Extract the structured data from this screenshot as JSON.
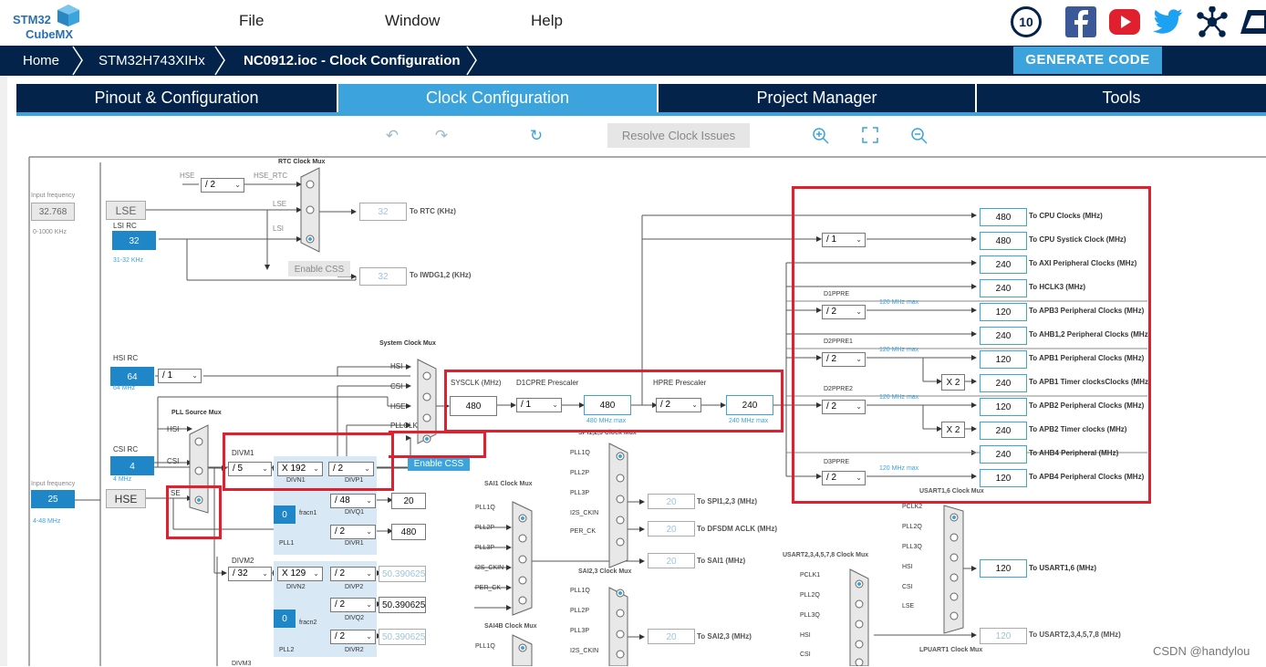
{
  "logo": {
    "line1": "STM32",
    "line2": "CubeMX"
  },
  "menu": [
    "File",
    "Window",
    "Help"
  ],
  "breadcrumb": [
    "Home",
    "STM32H743XIHx",
    "NC0912.ioc - Clock Configuration"
  ],
  "generate_label": "GENERATE CODE",
  "tabs": [
    "Pinout & Configuration",
    "Clock Configuration",
    "Project Manager",
    "Tools"
  ],
  "toolbar": {
    "resolve_label": "Resolve Clock Issues"
  },
  "badge_10": "10",
  "watermark": "CSDN @handylou",
  "colors": {
    "navy": "#03234b",
    "accent": "#3ca3dc",
    "highlight_red": "#e0202e",
    "box_blue": "#1f86c8"
  },
  "icons": [
    "undo-icon",
    "redo-icon",
    "refresh-icon",
    "zoom-in-icon",
    "fit-screen-icon",
    "zoom-out-icon",
    "facebook-icon",
    "youtube-icon",
    "twitter-icon",
    "network-icon"
  ],
  "clock": {
    "input_freq_label": "Input frequency",
    "lse_value": "32.768",
    "lse_range": "0-1000 KHz",
    "lse_label": "LSE",
    "lsi_rc_label": "LSI RC",
    "lsi_value": "32",
    "lsi_range": "31-32 KHz",
    "rtc_mux_label": "RTC Clock Mux",
    "hse_label_small": "HSE",
    "hse_rtc_label": "HSE_RTC",
    "lse_small": "LSE",
    "lsi_small": "LSI",
    "div2": "/ 2",
    "rtc_value": "32",
    "rtc_out": "To RTC (KHz)",
    "enable_css": "Enable CSS",
    "iwdg_value": "32",
    "iwdg_out": "To IWDG1,2 (KHz)",
    "hsi_rc_label": "HSI RC",
    "hsi_value": "64",
    "hsi_freq": "64 MHz",
    "hsi_div": "/ 1",
    "csi_rc_label": "CSI RC",
    "csi_value": "4",
    "csi_freq": "4 MHz",
    "hse_input_label": "Input frequency",
    "hse_value": "25",
    "hse_range": "4-48 MHz",
    "hse_box": "HSE",
    "pll_source_mux": "PLL Source Mux",
    "pll_hsi": "HSI",
    "pll_csi": "CSI",
    "pll_se": "SE",
    "sys_mux": "System Clock Mux",
    "sys_hsi": "HSI",
    "sys_csi": "CSI",
    "sys_hse": "HSE",
    "sys_pllclk": "PLLCLK",
    "sysclk_label": "SYSCLK (MHz)",
    "sysclk_value": "480",
    "d1cpre_label": "D1CPRE Prescaler",
    "d1cpre_value": "/ 1",
    "d1cpre_out": "480",
    "d1cpre_max": "480 MHz max",
    "hpre_label": "HPRE Prescaler",
    "hpre_value": "/ 2",
    "hpre_out": "240",
    "hpre_max": "240 MHz max",
    "divm1_label": "DIVM1",
    "divm1_value": "/ 5",
    "divn1_value": "X 192",
    "divn1_label": "DIVN1",
    "divp1_value": "/ 2",
    "divp1_label": "DIVP1",
    "fracn1_value": "0",
    "fracn1_label": "fracn1",
    "divq1_value": "/ 48",
    "divq1_label": "DIVQ1",
    "divq1_out": "20",
    "divr1_value": "/ 2",
    "divr1_label": "DIVR1",
    "divr1_out": "480",
    "pll1_label": "PLL1",
    "divm2_label": "DIVM2",
    "divm2_value": "/ 32",
    "divn2_value": "X 129",
    "divn2_label": "DIVN2",
    "divp2_value": "/ 2",
    "divp2_label": "DIVP2",
    "divp2_out": "50.390625",
    "fracn2_value": "0",
    "fracn2_label": "fracn2",
    "divq2_value": "/ 2",
    "divq2_label": "DIVQ2",
    "divq2_out": "50.390625",
    "divr2_value": "/ 2",
    "divr2_label": "DIVR2",
    "divr2_out": "50.390625",
    "pll2_label": "PLL2",
    "divm3_label": "DIVM3",
    "spi123_mux": "SPI1,2,3 Clock Mux",
    "spi_pll1q": "PLL1Q",
    "spi_pll2p": "PLL2P",
    "spi_pll3p": "PLL3P",
    "spi_i2sckin": "I2S_CKIN",
    "spi_perck": "PER_CK",
    "spi_value": "20",
    "spi_out": "To SPI1,2,3 (MHz)",
    "dfsdm_value": "20",
    "dfsdm_out": "To DFSDM ACLK (MHz)",
    "sai1_mux": "SAI1 Clock Mux",
    "sai1_pll1q": "PLL1Q",
    "sai1_pll2p": "PLL2P",
    "sai1_pll3p": "PLL3P",
    "sai1_i2sckin": "I2S_CKIN",
    "sai1_perck": "PER_CK",
    "sai1_value": "20",
    "sai1_out": "To SAI1 (MHz)",
    "sai23_mux": "SAI2,3 Clock Mux",
    "sai23_pll1q": "PLL1Q",
    "sai23_pll2p": "PLL2P",
    "sai23_pll3p": "PLL3P",
    "sai23_i2sckin": "I2S_CKIN",
    "sai23_value": "20",
    "sai23_out": "To SAI2,3 (MHz)",
    "sai4b_mux": "SAI4B Clock Mux",
    "sai4b_pll1q": "PLL1Q",
    "cpu_div": "/ 1",
    "d1ppre_label": "D1PPRE",
    "d1ppre_value": "/ 2",
    "d2ppre1_label": "D2PPRE1",
    "d2ppre1_value": "/ 2",
    "d2ppre2_label": "D2PPRE2",
    "d2ppre2_value": "/ 2",
    "d3ppre_label": "D3PPRE",
    "d3ppre_value": "/ 2",
    "max120": "120 MHz max",
    "x2": "X 2",
    "outputs": [
      {
        "value": "480",
        "label": "To CPU Clocks (MHz)"
      },
      {
        "value": "480",
        "label": "To CPU Systick Clock (MHz)"
      },
      {
        "value": "240",
        "label": "To AXI Peripheral Clocks (MHz)"
      },
      {
        "value": "240",
        "label": "To HCLK3 (MHz)"
      },
      {
        "value": "120",
        "label": "To APB3 Peripheral Clocks (MHz)"
      },
      {
        "value": "240",
        "label": "To AHB1,2 Peripheral Clocks (MHz)"
      },
      {
        "value": "120",
        "label": "To APB1 Peripheral Clocks (MHz)"
      },
      {
        "value": "240",
        "label": "To APB1 Timer clocksClocks (MHz)"
      },
      {
        "value": "120",
        "label": "To APB2 Peripheral Clocks (MHz)"
      },
      {
        "value": "240",
        "label": "To APB2 Timer clocks (MHz)"
      },
      {
        "value": "240",
        "label": "To AHB4 Peripheral (MHz)"
      },
      {
        "value": "120",
        "label": "To APB4 Peripheral Clocks (MHz)"
      }
    ],
    "usart16_mux": "USART1,6 Clock Mux",
    "usart16_inputs": [
      "PCLK2",
      "PLL2Q",
      "PLL3Q",
      "HSI",
      "CSI",
      "LSE"
    ],
    "usart16_value": "120",
    "usart16_out": "To USART1,6 (MHz)",
    "usart2_mux": "USART2,3,4,5,7,8 Clock Mux",
    "usart2_inputs": [
      "PCLK1",
      "PLL2Q",
      "PLL3Q",
      "HSI",
      "CSI"
    ],
    "usart2_value": "120",
    "usart2_out": "To USART2,3,4,5,7,8 (MHz)",
    "lpuart1_mux": "LPUART1 Clock Mux"
  }
}
